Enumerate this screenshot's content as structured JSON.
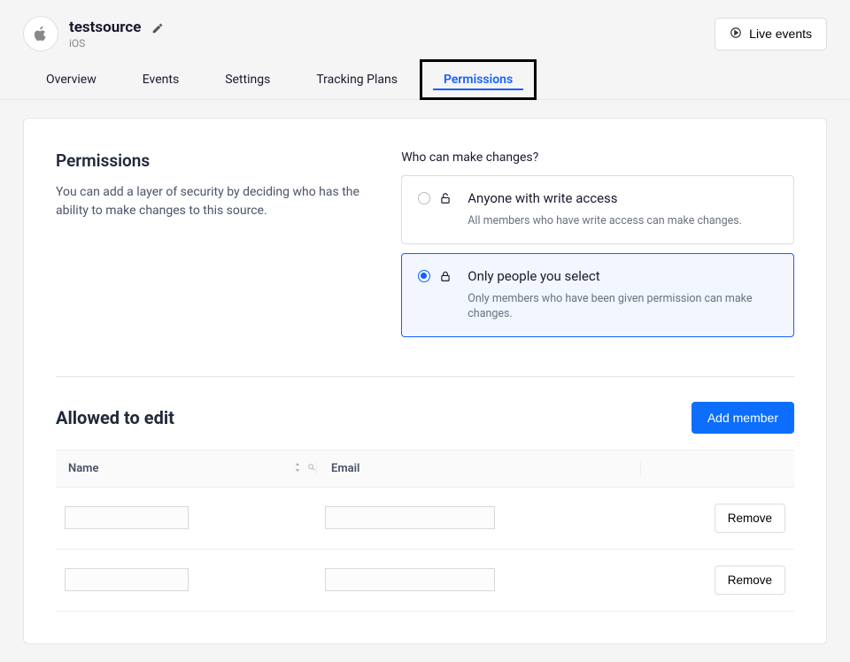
{
  "header": {
    "title": "testsource",
    "platform": "iOS",
    "live_events_label": "Live events"
  },
  "tabs": {
    "items": [
      {
        "label": "Overview",
        "active": false
      },
      {
        "label": "Events",
        "active": false
      },
      {
        "label": "Settings",
        "active": false
      },
      {
        "label": "Tracking Plans",
        "active": false
      },
      {
        "label": "Permissions",
        "active": true
      }
    ]
  },
  "permissions": {
    "heading": "Permissions",
    "description": "You can add a layer of security by deciding who has the ability to make changes to this source.",
    "who_label": "Who can make changes?",
    "options": [
      {
        "title": "Anyone with write access",
        "description": "All members who have write access can make changes.",
        "selected": false,
        "lock": "unlocked"
      },
      {
        "title": "Only people you select",
        "description": "Only members who have been given permission can make changes.",
        "selected": true,
        "lock": "locked"
      }
    ]
  },
  "allowed": {
    "heading": "Allowed to edit",
    "add_member_label": "Add member",
    "columns": {
      "name": "Name",
      "email": "Email"
    },
    "rows": [
      {
        "name": "",
        "email": "",
        "remove_label": "Remove"
      },
      {
        "name": "",
        "email": "",
        "remove_label": "Remove"
      }
    ]
  }
}
